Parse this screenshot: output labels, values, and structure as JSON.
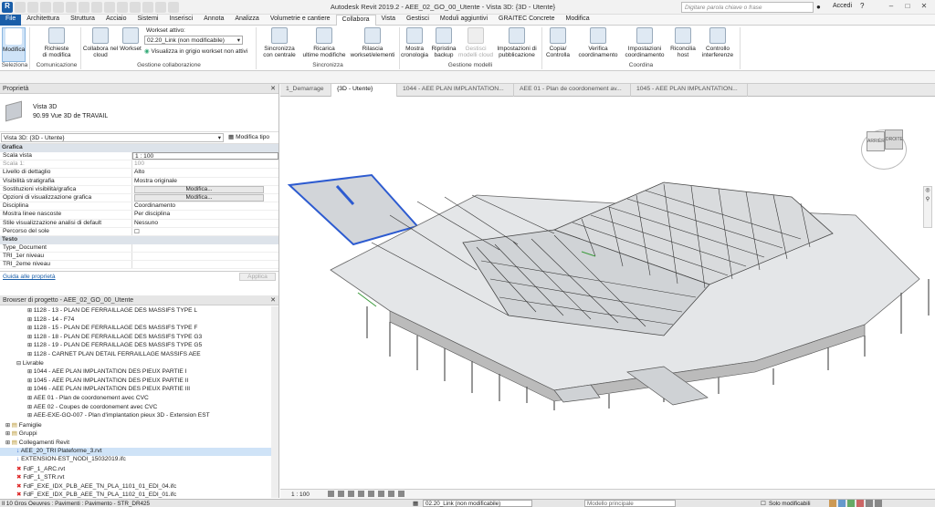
{
  "app": {
    "title": "Autodesk Revit 2019.2 - AEE_02_GO_00_Utente - Vista 3D: {3D - Utente}",
    "search_placeholder": "Digitare parola chiave o frase",
    "user": "Accedi",
    "accent": "#1a5ea8"
  },
  "tabs": [
    "File",
    "Architettura",
    "Struttura",
    "Acciaio",
    "Sistemi",
    "Inserisci",
    "Annota",
    "Analizza",
    "Volumetrie e cantiere",
    "Collabora",
    "Vista",
    "Gestisci",
    "Moduli aggiuntivi",
    "GRAITEC Concrete",
    "Modifica"
  ],
  "ribbon": {
    "modify": "Modifica",
    "requests": "Richieste\ndi modifica",
    "collab_cloud": "Collabora nel\ncloud",
    "workset": "Workset",
    "workset_active_label": "Workset attivo:",
    "workset_value": "02.20_Link (non modificabile)",
    "show_gray": "Visualizza in grigio workset non attivi",
    "sync": "Sincronizza\ncon centrale",
    "reload": "Ricarica\nultime modifiche",
    "relinquish": "Rilascia\nworkset/elementi",
    "history": "Mostra\ncronologia",
    "restore": "Ripristina\nbackup",
    "manage_cloud": "Gestisci\nmodelli cloud",
    "publish": "Impostazioni di\npubblicazione",
    "copy_monitor": "Copia/\nControlla",
    "coord_review": "Verifica\ncoordinamento",
    "coord_settings": "Impostazioni\ncoordinamento",
    "reconcile": "Riconcilia\nhost",
    "interference": "Controllo\ninterferenze",
    "groups": {
      "select": "Seleziona",
      "communicate": "Comunicazione",
      "manage_collab": "Gestione collaborazione",
      "synchronize": "Sincronizza",
      "manage_models": "Gestione modelli",
      "coordinate": "Coordina"
    }
  },
  "properties": {
    "title": "Proprietà",
    "type_name": "Vista 3D",
    "type_sub": "90.99 Vue 3D de TRAVAIL",
    "selector": "Vista 3D: {3D - Utente}",
    "edit_type": "Modifica tipo",
    "group_graphics": "Grafica",
    "rows": [
      {
        "k": "Scala vista",
        "v": "1 : 100"
      },
      {
        "k": "Scala   1:",
        "v": "100"
      },
      {
        "k": "Livello di dettaglio",
        "v": "Alto"
      },
      {
        "k": "Visibilità stratigrafia",
        "v": "Mostra originale"
      },
      {
        "k": "Sostituzioni visibilità/grafica",
        "v": "Modifica..."
      },
      {
        "k": "Opzioni di visualizzazione grafica",
        "v": "Modifica..."
      },
      {
        "k": "Disciplina",
        "v": "Coordinamento"
      },
      {
        "k": "Mostra linee nascoste",
        "v": "Per disciplina"
      },
      {
        "k": "Stile visualizzazione analisi di default",
        "v": "Nessuno"
      },
      {
        "k": "Percorso del sole",
        "v": ""
      }
    ],
    "group_text": "Testo",
    "text_rows": [
      "Type_Document",
      "TRI_1er niveau",
      "TRI_2eme niveau"
    ],
    "help": "Guida alle proprietà",
    "apply": "Applica"
  },
  "browser": {
    "title": "Browser di progetto - AEE_02_GO_00_Utente",
    "items": [
      {
        "t": "1128 - 13 - PLAN DE FERRAILLAGE DES MASSIFS TYPE L",
        "lvl": 2
      },
      {
        "t": "1128 - 14 - F74",
        "lvl": 2
      },
      {
        "t": "1128 - 15 - PLAN DE FERRAILLAGE DES MASSIFS TYPE F",
        "lvl": 2
      },
      {
        "t": "1128 - 18 - PLAN DE FERRAILLAGE DES MASSIFS TYPE G3",
        "lvl": 2
      },
      {
        "t": "1128 - 19 - PLAN DE FERRAILLAGE DES MASSIFS TYPE G5",
        "lvl": 2
      },
      {
        "t": "1128 - CARNET PLAN DETAIL FERRAILLAGE MASSIFS AEE",
        "lvl": 2
      },
      {
        "t": "Livrable",
        "lvl": 1
      },
      {
        "t": "1044 - AEE PLAN IMPLANTATION DES PIEUX PARTIE I",
        "lvl": 2
      },
      {
        "t": "1045 - AEE PLAN IMPLANTATION DES PIEUX PARTIE II",
        "lvl": 2
      },
      {
        "t": "1046 - AEE PLAN IMPLANTATION DES PIEUX PARTIE III",
        "lvl": 2
      },
      {
        "t": "AEE 01 - Plan de coordonement avec CVC",
        "lvl": 2
      },
      {
        "t": "AEE 02 - Coupes  de coordonement avec CVC",
        "lvl": 2
      },
      {
        "t": "AEE-EXE-GO-007 - Plan d'implantation pieux 3D - Extension EST",
        "lvl": 2
      },
      {
        "t": "Famiglie",
        "lvl": 0
      },
      {
        "t": "Gruppi",
        "lvl": 0
      },
      {
        "t": "Collegamenti Revit",
        "lvl": 0
      },
      {
        "t": "AEE_20_TRI Plateforme_3.rvt",
        "lvl": 1,
        "sel": true,
        "ic": "blue"
      },
      {
        "t": "EXTENSION-EST_NODI_15032019.ifc",
        "lvl": 1,
        "ic": "blue"
      },
      {
        "t": "FdF_1_ARC.rvt",
        "lvl": 1,
        "ic": "red"
      },
      {
        "t": "FdF_1_STR.rvt",
        "lvl": 1,
        "ic": "red"
      },
      {
        "t": "FdF_EXE_IDX_PLB_AEE_TN_PLA_1101_01_EDI_04.ifc",
        "lvl": 1,
        "ic": "red"
      },
      {
        "t": "FdF_EXE_IDX_PLB_AEE_TN_PLA_1102_01_EDI_01.ifc",
        "lvl": 1,
        "ic": "red"
      }
    ]
  },
  "view_tabs": [
    {
      "t": "1_Demarrage",
      "active": false
    },
    {
      "t": "{3D - Utente}",
      "active": true
    },
    {
      "t": "1044 - AEE PLAN IMPLANTATION...",
      "active": false
    },
    {
      "t": "AEE 01 - Plan de coordonement av...",
      "active": false
    },
    {
      "t": "1045 - AEE PLAN IMPLANTATION...",
      "active": false
    }
  ],
  "viewcube": {
    "front": "ARRIÈRE",
    "right": "DROITE"
  },
  "view_status": {
    "scale": "1 : 100"
  },
  "status_bar": {
    "left": "Il 10  Gros Oeuvres : Pavimenti : Pavimento - STR_DR425",
    "workset": "02.20_Link (non modificabile)",
    "model": "Modello principale",
    "editable": "Solo modificabili"
  }
}
